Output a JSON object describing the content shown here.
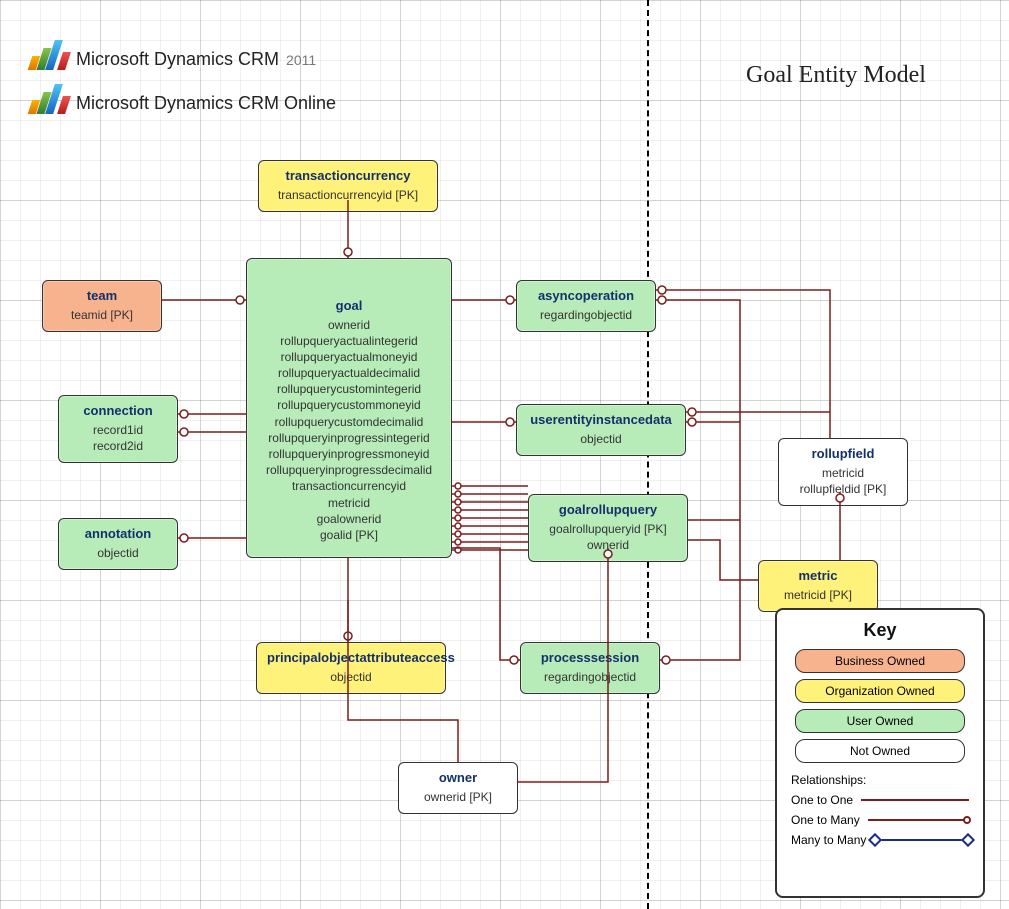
{
  "title": "Goal Entity Model",
  "branding": {
    "line1_prefix": "Microsoft Dynamics CRM",
    "line1_suffix": "2011",
    "line2": "Microsoft Dynamics CRM Online"
  },
  "entities": {
    "team": {
      "name": "team",
      "attrs": "teamid  [PK]",
      "color": "business"
    },
    "connection": {
      "name": "connection",
      "attrs": "record1id\nrecord2id",
      "color": "user"
    },
    "annotation": {
      "name": "annotation",
      "attrs": "objectid",
      "color": "user"
    },
    "transactioncurrency": {
      "name": "transactioncurrency",
      "attrs": "transactioncurrencyid  [PK]",
      "color": "org"
    },
    "goal": {
      "name": "goal",
      "attrs": "ownerid\nrollupqueryactualintegerid\nrollupqueryactualmoneyid\nrollupqueryactualdecimalid\nrollupquerycustomintegerid\nrollupquerycustommoneyid\nrollupquerycustomdecimalid\nrollupqueryinprogressintegerid\nrollupqueryinprogressmoneyid\nrollupqueryinprogressdecimalid\ntransactioncurrencyid\nmetricid\ngoalownerid\ngoalid  [PK]",
      "color": "user"
    },
    "asyncoperation": {
      "name": "asyncoperation",
      "attrs": "regardingobjectid",
      "color": "user"
    },
    "userentityinstancedata": {
      "name": "userentityinstancedata",
      "attrs": "objectid",
      "color": "user"
    },
    "goalrollupquery": {
      "name": "goalrollupquery",
      "attrs": "goalrollupqueryid  [PK]\nownerid",
      "color": "user"
    },
    "processsession": {
      "name": "processsession",
      "attrs": "regardingobjectid",
      "color": "user"
    },
    "principalobjectattributeaccess": {
      "name": "principalobjectattributeaccess",
      "attrs": "objectid",
      "color": "org"
    },
    "owner": {
      "name": "owner",
      "attrs": "ownerid  [PK]",
      "color": "none"
    },
    "rollupfield": {
      "name": "rollupfield",
      "attrs": "metricid\nrollupfieldid  [PK]",
      "color": "none"
    },
    "metric": {
      "name": "metric",
      "attrs": "metricid  [PK]",
      "color": "org"
    }
  },
  "key": {
    "title": "Key",
    "swatches": {
      "business": "Business Owned",
      "org": "Organization Owned",
      "user": "User Owned",
      "none": "Not Owned"
    },
    "relationships_label": "Relationships:",
    "one_to_one": "One to One",
    "one_to_many": "One to Many",
    "many_to_many": "Many to Many"
  },
  "colors": {
    "business": "#f7b28e",
    "org": "#fff27a",
    "user": "#b7ecb9",
    "none": "#ffffff",
    "relation_red": "#7a1d1d",
    "relation_blue": "#1a2d8a"
  },
  "relationships": [
    {
      "from": "transactioncurrency",
      "to": "goal",
      "type": "one_to_many"
    },
    {
      "from": "team",
      "to": "goal",
      "type": "one_to_many"
    },
    {
      "from": "goal",
      "to": "connection",
      "type": "one_to_many",
      "count": 2
    },
    {
      "from": "goal",
      "to": "annotation",
      "type": "one_to_many"
    },
    {
      "from": "goal",
      "to": "principalobjectattributeaccess",
      "type": "one_to_many"
    },
    {
      "from": "goal",
      "to": "asyncoperation",
      "type": "one_to_many"
    },
    {
      "from": "goal",
      "to": "userentityinstancedata",
      "type": "one_to_many"
    },
    {
      "from": "goal",
      "to": "processsession",
      "type": "one_to_many"
    },
    {
      "from": "goalrollupquery",
      "to": "goal",
      "type": "one_to_many",
      "count": 10
    },
    {
      "from": "metric",
      "to": "goal",
      "type": "one_to_many"
    },
    {
      "from": "owner",
      "to": "goal",
      "type": "one_to_many"
    },
    {
      "from": "owner",
      "to": "goalrollupquery",
      "type": "one_to_many"
    },
    {
      "from": "goalrollupquery",
      "to": "asyncoperation",
      "type": "one_to_many"
    },
    {
      "from": "goalrollupquery",
      "to": "userentityinstancedata",
      "type": "one_to_many"
    },
    {
      "from": "goalrollupquery",
      "to": "processsession",
      "type": "one_to_many"
    },
    {
      "from": "goalrollupquery",
      "to": "principalobjectattributeaccess",
      "type": "one_to_many"
    },
    {
      "from": "metric",
      "to": "rollupfield",
      "type": "one_to_many"
    },
    {
      "from": "metric",
      "to": "asyncoperation",
      "type": "one_to_many"
    },
    {
      "from": "metric",
      "to": "userentityinstancedata",
      "type": "one_to_many"
    },
    {
      "from": "metric",
      "to": "processsession",
      "type": "one_to_many"
    },
    {
      "from": "metric",
      "to": "principalobjectattributeaccess",
      "type": "one_to_many"
    },
    {
      "from": "metric",
      "to": "goalrollupquery",
      "type": "one_to_many"
    },
    {
      "from": "rollupfield",
      "to": "asyncoperation",
      "type": "one_to_many"
    },
    {
      "from": "rollupfield",
      "to": "userentityinstancedata",
      "type": "one_to_many"
    },
    {
      "from": "rollupfield",
      "to": "processsession",
      "type": "one_to_many"
    }
  ]
}
